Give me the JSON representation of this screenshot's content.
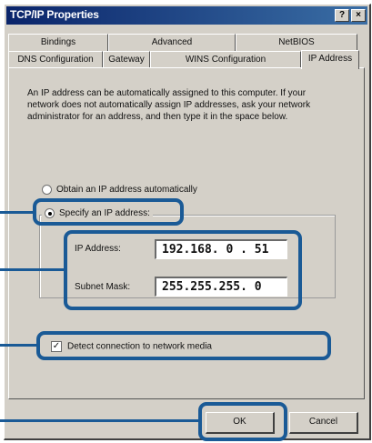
{
  "window": {
    "title": "TCP/IP Properties",
    "help_glyph": "?",
    "close_glyph": "×"
  },
  "tabs": {
    "row_back": [
      "Bindings",
      "Advanced",
      "NetBIOS"
    ],
    "row_front": [
      "DNS Configuration",
      "Gateway",
      "WINS Configuration",
      "IP Address"
    ],
    "active": "IP Address"
  },
  "description": "An IP address can be automatically assigned to this computer. If your network does not automatically assign IP addresses, ask your network administrator for an address, and then type it in the space below.",
  "radios": {
    "obtain": {
      "label": "Obtain an IP address automatically",
      "selected": false
    },
    "specify": {
      "label": "Specify an IP address:",
      "selected": true
    }
  },
  "fields": {
    "ip_label": "IP Address:",
    "ip_value": "192.168. 0 . 51",
    "mask_label": "Subnet Mask:",
    "mask_value": "255.255.255. 0"
  },
  "checkbox": {
    "label": "Detect connection to network media",
    "checked": true,
    "check_glyph": "✓"
  },
  "buttons": {
    "ok": "OK",
    "cancel": "Cancel"
  },
  "colors": {
    "callout": "#1a5a96",
    "titlebar": "#0a246a",
    "face": "#d4d0c8"
  },
  "icons": [
    "help-icon",
    "close-icon"
  ]
}
